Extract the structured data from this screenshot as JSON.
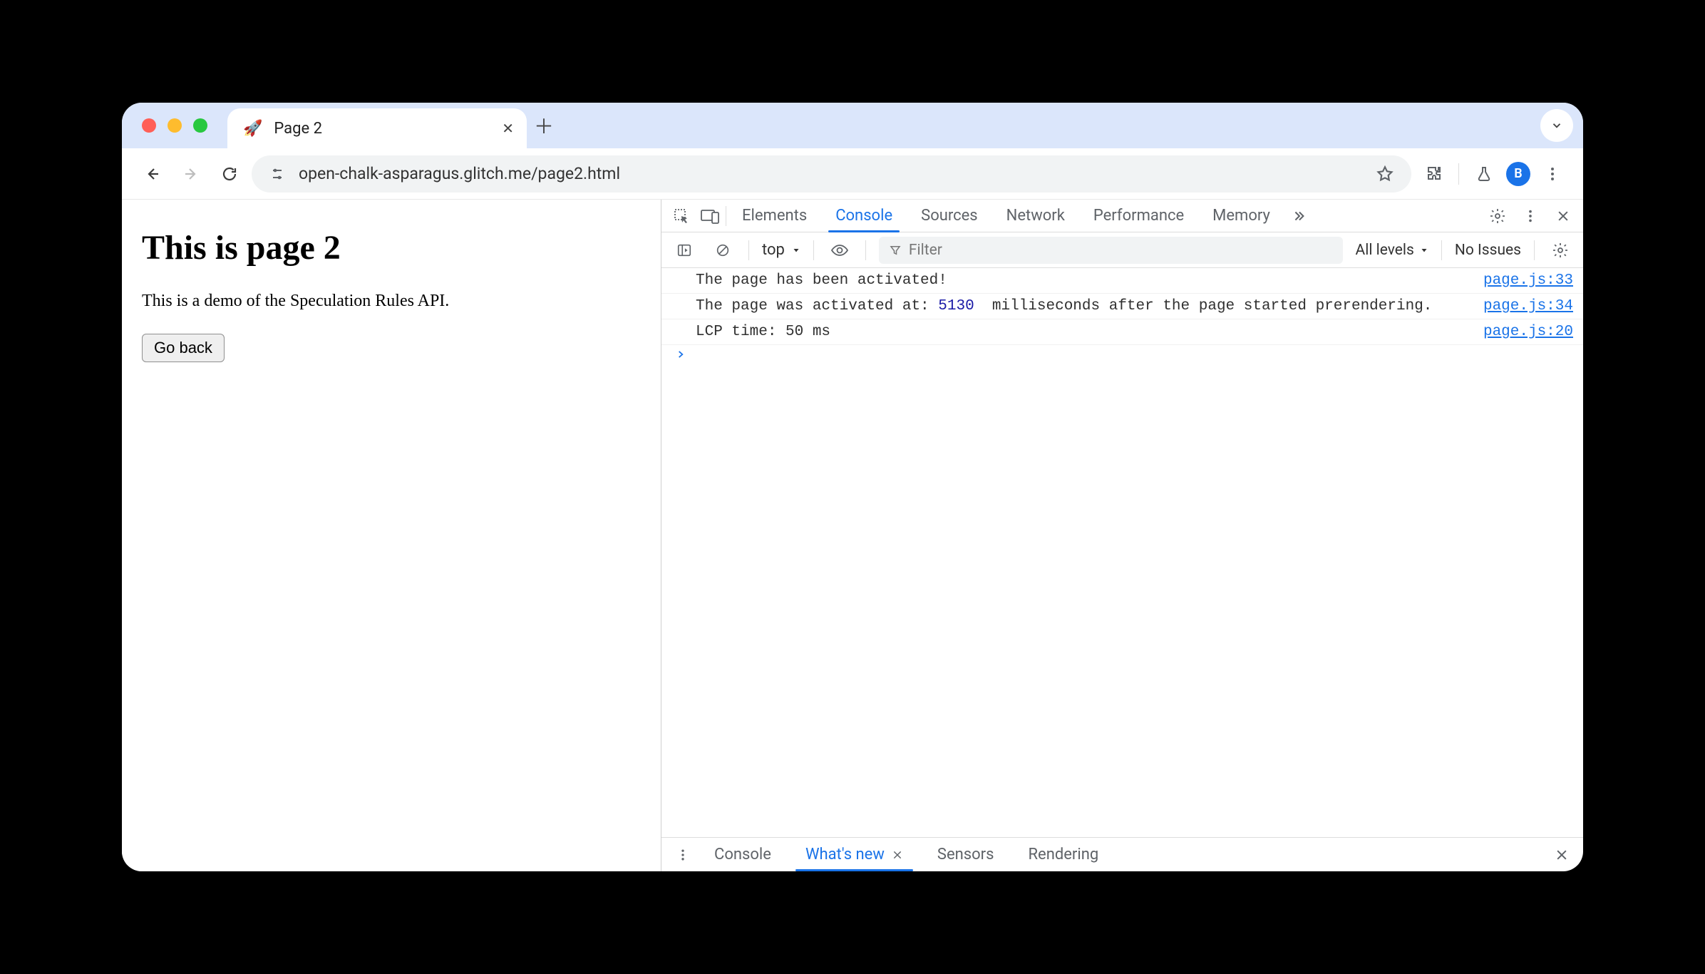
{
  "browser": {
    "tab_title": "Page 2",
    "favicon": "🚀",
    "url": "open-chalk-asparagus.glitch.me/page2.html",
    "avatar_letter": "B"
  },
  "page": {
    "heading": "This is page 2",
    "body": "This is a demo of the Speculation Rules API.",
    "button": "Go back"
  },
  "devtools": {
    "tabs": [
      "Elements",
      "Console",
      "Sources",
      "Network",
      "Performance",
      "Memory"
    ],
    "active_tab": "Console",
    "context": "top",
    "filter_placeholder": "Filter",
    "levels": "All levels",
    "issues": "No Issues",
    "logs": [
      {
        "pre": "The page has been activated!",
        "num": "",
        "post": "",
        "src": "page.js:33"
      },
      {
        "pre": "The page was activated at: ",
        "num": "5130",
        "post": "  milliseconds after the page started prerendering.",
        "src": "page.js:34"
      },
      {
        "pre": "LCP time: 50 ms",
        "num": "",
        "post": "",
        "src": "page.js:20"
      }
    ],
    "drawer": {
      "tabs": [
        "Console",
        "What's new",
        "Sensors",
        "Rendering"
      ],
      "active": "What's new"
    }
  }
}
